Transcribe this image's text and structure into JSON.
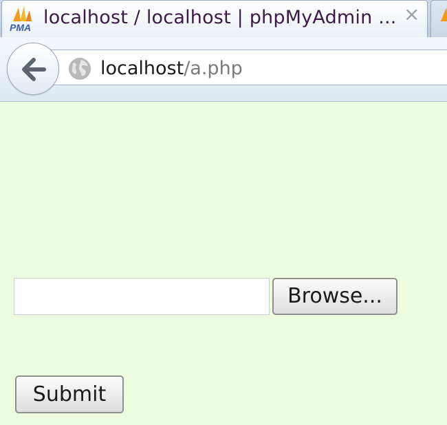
{
  "browser": {
    "tab_title": "localhost / localhost | phpMyAdmin ...",
    "tab_close": "×",
    "favicon_text": "PMA",
    "url_host": "localhost",
    "url_path": "/a.php",
    "icons": {
      "favicon": "phpmyadmin-logo-icon",
      "back": "back-arrow-icon",
      "site": "globe-icon",
      "close": "close-icon"
    }
  },
  "form": {
    "file_input_value": "",
    "browse_label": "Browse...",
    "submit_label": "Submit"
  },
  "colors": {
    "page_background": "#edfcdf",
    "tab_title_text": "#3c1a48",
    "url_path_text": "#7a7a7a"
  }
}
